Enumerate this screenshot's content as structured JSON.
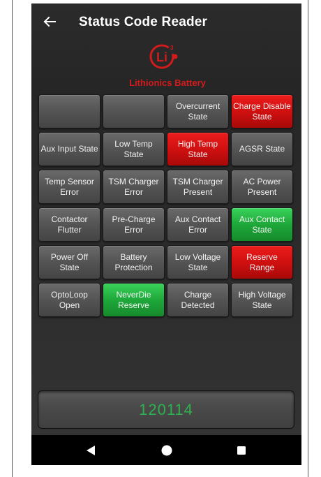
{
  "app": {
    "title": "Status Code Reader"
  },
  "logo": {
    "mark": "Li",
    "superscript": "3",
    "name": "Lithionics Battery"
  },
  "tiles": [
    {
      "label": "",
      "state": "gray"
    },
    {
      "label": "",
      "state": "gray"
    },
    {
      "label": "Overcurrent\nState",
      "state": "gray"
    },
    {
      "label": "Charge Disable\nState",
      "state": "red"
    },
    {
      "label": "Aux Input State",
      "state": "gray"
    },
    {
      "label": "Low Temp State",
      "state": "gray"
    },
    {
      "label": "High Temp State",
      "state": "red"
    },
    {
      "label": "AGSR State",
      "state": "gray"
    },
    {
      "label": "Temp Sensor\nError",
      "state": "gray"
    },
    {
      "label": "TSM Charger\nError",
      "state": "gray"
    },
    {
      "label": "TSM Charger\nPresent",
      "state": "gray"
    },
    {
      "label": "AC Power\nPresent",
      "state": "gray"
    },
    {
      "label": "Contactor\nFlutter",
      "state": "gray"
    },
    {
      "label": "Pre-Charge Error",
      "state": "gray"
    },
    {
      "label": "Aux Contact\nError",
      "state": "gray"
    },
    {
      "label": "Aux Contact\nState",
      "state": "green"
    },
    {
      "label": "Power Off State",
      "state": "gray"
    },
    {
      "label": "Battery\nProtection",
      "state": "gray"
    },
    {
      "label": "Low Voltage\nState",
      "state": "gray"
    },
    {
      "label": "Reserve Range",
      "state": "red"
    },
    {
      "label": "OptoLoop Open",
      "state": "gray"
    },
    {
      "label": "NeverDie\nReserve",
      "state": "green"
    },
    {
      "label": "Charge\nDetected",
      "state": "gray"
    },
    {
      "label": "High Voltage\nState",
      "state": "gray"
    }
  ],
  "status_code": "120114",
  "icons": {
    "back": "arrow-left-icon",
    "nav_back": "triangle-back-icon",
    "nav_home": "circle-home-icon",
    "nav_recents": "square-recents-icon"
  },
  "colors": {
    "active_red": "#d01010",
    "active_green": "#1ea83a",
    "inactive_gray": "#555555",
    "code_green": "#2db24d",
    "brand_red": "#d21b1b"
  }
}
